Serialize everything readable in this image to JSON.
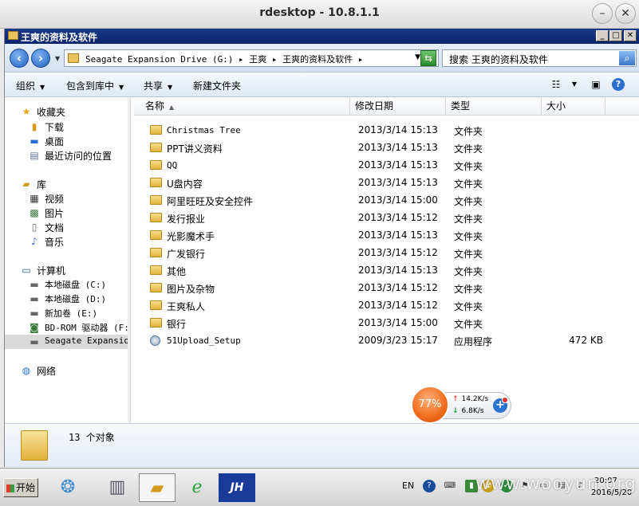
{
  "rdesktop": {
    "title": "rdesktop - 10.8.1.1",
    "min_glyph": "–",
    "close_glyph": "✕"
  },
  "window": {
    "title": "王爽的资料及软件",
    "controls": {
      "min": "_",
      "max": "□",
      "close": "✕"
    }
  },
  "address": {
    "path": "Seagate Expansion Drive (G:) ▸ 王爽 ▸ 王爽的资料及软件 ▸",
    "search_placeholder": "搜索 王爽的资料及软件"
  },
  "toolbar": {
    "organize": "组织",
    "include_in_library": "包含到库中",
    "share": "共享",
    "new_folder": "新建文件夹"
  },
  "nav": {
    "favorites": "收藏夹",
    "downloads": "下载",
    "desktop": "桌面",
    "recent": "最近访问的位置",
    "libraries": "库",
    "videos": "视频",
    "pictures": "图片",
    "documents": "文档",
    "music": "音乐",
    "computer": "计算机",
    "disk_c": "本地磁盘 (C:)",
    "disk_d": "本地磁盘 (D:)",
    "volume_e": "新加卷 (E:)",
    "bdrom_f": "BD-ROM 驱动器 (F:)",
    "seagate": "Seagate Expansion",
    "network": "网络"
  },
  "columns": {
    "name": "名称",
    "date": "修改日期",
    "type": "类型",
    "size": "大小"
  },
  "files": [
    {
      "name": "Christmas Tree",
      "date": "2013/3/14 15:13",
      "type": "文件夹",
      "size": ""
    },
    {
      "name": "PPT讲义资料",
      "date": "2013/3/14 15:13",
      "type": "文件夹",
      "size": ""
    },
    {
      "name": "QQ",
      "date": "2013/3/14 15:13",
      "type": "文件夹",
      "size": ""
    },
    {
      "name": "U盘内容",
      "date": "2013/3/14 15:13",
      "type": "文件夹",
      "size": ""
    },
    {
      "name": "阿里旺旺及安全控件",
      "date": "2013/3/14 15:00",
      "type": "文件夹",
      "size": ""
    },
    {
      "name": "发行报业",
      "date": "2013/3/14 15:12",
      "type": "文件夹",
      "size": ""
    },
    {
      "name": "光影魔术手",
      "date": "2013/3/14 15:13",
      "type": "文件夹",
      "size": ""
    },
    {
      "name": "广发银行",
      "date": "2013/3/14 15:12",
      "type": "文件夹",
      "size": ""
    },
    {
      "name": "其他",
      "date": "2013/3/14 15:13",
      "type": "文件夹",
      "size": ""
    },
    {
      "name": "图片及杂物",
      "date": "2013/3/14 15:12",
      "type": "文件夹",
      "size": ""
    },
    {
      "name": "王爽私人",
      "date": "2013/3/14 15:12",
      "type": "文件夹",
      "size": ""
    },
    {
      "name": "银行",
      "date": "2013/3/14 15:00",
      "type": "文件夹",
      "size": ""
    },
    {
      "name": "51Upload_Setup",
      "date": "2009/3/23 15:17",
      "type": "应用程序",
      "size": "472 KB"
    }
  ],
  "details": {
    "count_text": "13 个对象"
  },
  "netmon": {
    "percent": "77%",
    "up": "14.2K/s",
    "down": "6.8K/s"
  },
  "taskbar": {
    "start": "开始",
    "lang": "EN",
    "time": "20:07",
    "date": "2016/5/20"
  },
  "watermark": "www.wooyun.org",
  "colors": {
    "titlebar": "#0a246a",
    "accent": "#2a6fd0",
    "netball": "#f06a1a"
  }
}
